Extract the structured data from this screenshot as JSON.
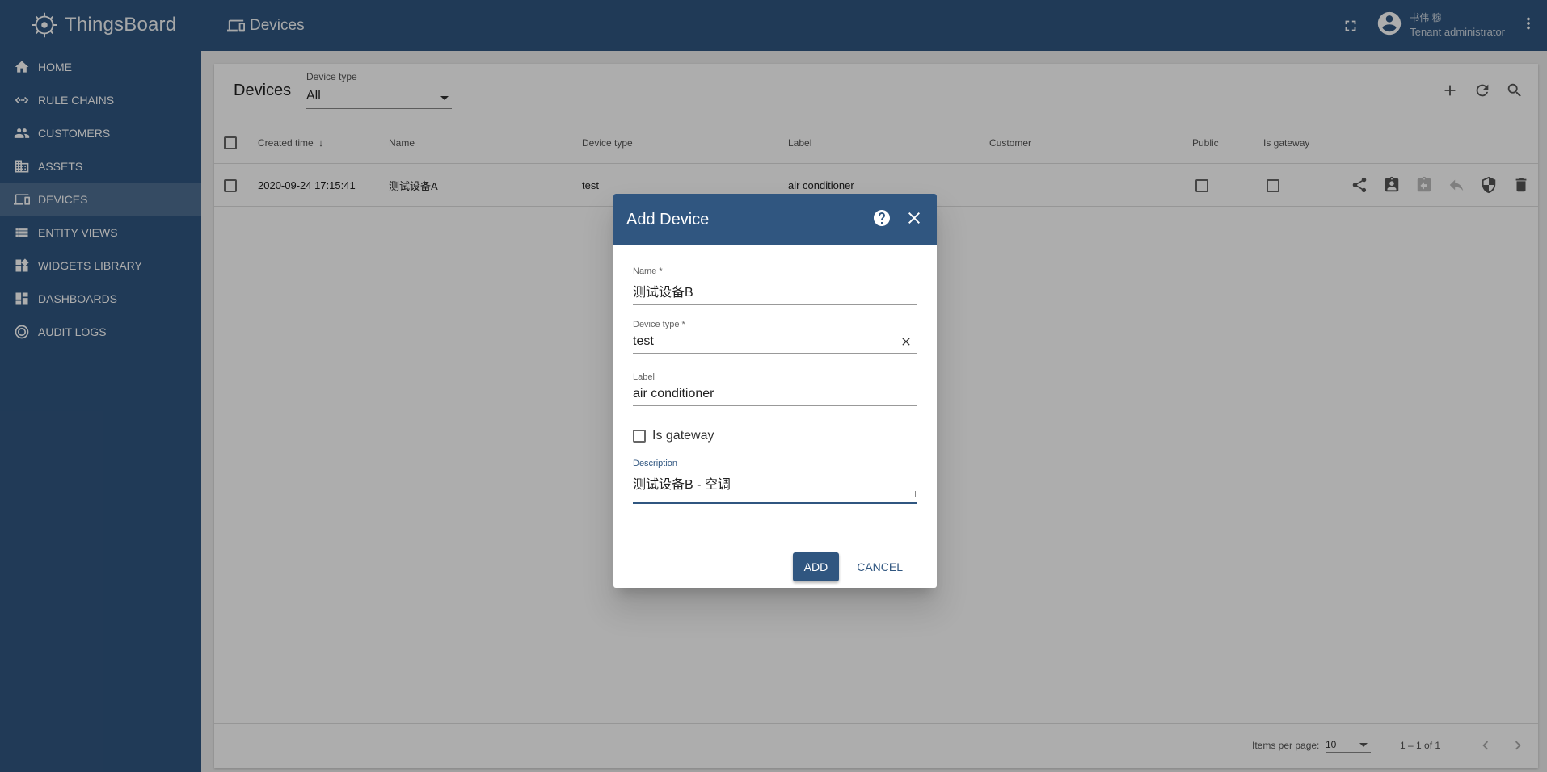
{
  "app": {
    "name": "ThingsBoard"
  },
  "sidebar": {
    "items": [
      {
        "label": "HOME",
        "icon": "home-icon"
      },
      {
        "label": "RULE CHAINS",
        "icon": "rule-chains-icon"
      },
      {
        "label": "CUSTOMERS",
        "icon": "customers-icon"
      },
      {
        "label": "ASSETS",
        "icon": "assets-icon"
      },
      {
        "label": "DEVICES",
        "icon": "devices-icon",
        "active": true
      },
      {
        "label": "ENTITY VIEWS",
        "icon": "entity-views-icon"
      },
      {
        "label": "WIDGETS LIBRARY",
        "icon": "widgets-icon"
      },
      {
        "label": "DASHBOARDS",
        "icon": "dashboards-icon"
      },
      {
        "label": "AUDIT LOGS",
        "icon": "audit-logs-icon"
      }
    ]
  },
  "header": {
    "title": "Devices",
    "user_name": "书伟 穆",
    "user_role": "Tenant administrator"
  },
  "main": {
    "title": "Devices",
    "filter_label": "Device type",
    "filter_value": "All",
    "columns": [
      "Created time",
      "Name",
      "Device type",
      "Label",
      "Customer",
      "Public",
      "Is gateway"
    ],
    "rows": [
      {
        "created": "2020-09-24 17:15:41",
        "name": "测试设备A",
        "type": "test",
        "label": "air conditioner",
        "customer": ""
      }
    ],
    "footer": {
      "items_per_page_label": "Items per page:",
      "items_per_page": "10",
      "range": "1 – 1 of 1"
    }
  },
  "dialog": {
    "title": "Add Device",
    "name_label": "Name *",
    "name_value": "测试设备B",
    "type_label": "Device type *",
    "type_value": "test",
    "label_label": "Label",
    "label_value": "air conditioner",
    "gateway_label": "Is gateway",
    "desc_label": "Description",
    "desc_value": "测试设备B - 空调",
    "add_label": "ADD",
    "cancel_label": "CANCEL"
  },
  "colors": {
    "primary": "#305680",
    "background": "#eeeeee"
  }
}
